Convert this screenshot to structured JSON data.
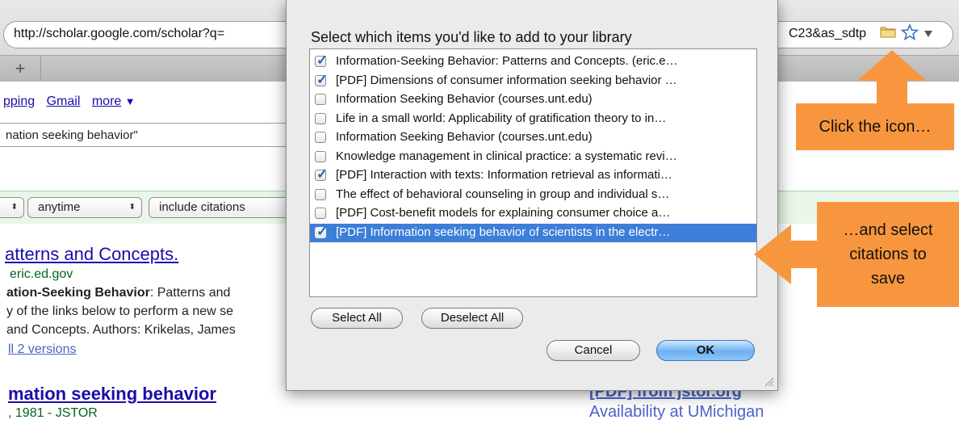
{
  "browser": {
    "url_left": "http://scholar.google.com/scholar?q=",
    "url_right": "C23&as_sdtp",
    "new_tab_label": "+"
  },
  "page": {
    "nav": {
      "shopping": "pping",
      "gmail": "Gmail",
      "more": "more",
      "more_caret": "▼"
    },
    "search_value": "nation seeking behavior\"",
    "filters": {
      "first_arrow": "⬍",
      "anytime": "anytime",
      "citations": "include citations"
    },
    "result1": {
      "title": "atterns and Concepts.",
      "source": "eric.ed.gov",
      "snippet1_bold": "ation-Seeking Behavior",
      "snippet1_rest": ": Patterns and",
      "snippet2": "y of the links below to perform a new se",
      "snippet3": "and Concepts. Authors: Krikelas, James",
      "versions": "ll 2 versions"
    },
    "result2": {
      "title": "mation seeking behavior",
      "source": ", 1981 - JSTOR"
    },
    "right_links": {
      "pdf_jstor": "[PDF] from jstor.org",
      "availability": "Availability at UMichigan"
    }
  },
  "dialog": {
    "title": "Select which items you'd like to add to your library",
    "items": [
      {
        "label": "Information-Seeking Behavior: Patterns and Concepts. (eric.e…",
        "checked": true,
        "selected": false
      },
      {
        "label": "[PDF] Dimensions of consumer information seeking behavior …",
        "checked": true,
        "selected": false
      },
      {
        "label": "Information Seeking Behavior (courses.unt.edu)",
        "checked": false,
        "selected": false
      },
      {
        "label": "Life in a small world: Applicability of gratification theory to in…",
        "checked": false,
        "selected": false
      },
      {
        "label": "Information Seeking Behavior (courses.unt.edu)",
        "checked": false,
        "selected": false
      },
      {
        "label": "Knowledge management in clinical practice: a systematic revi…",
        "checked": false,
        "selected": false
      },
      {
        "label": "[PDF] Interaction with texts: Information retrieval as informati…",
        "checked": true,
        "selected": false
      },
      {
        "label": "The effect of behavioral counseling in group and individual s…",
        "checked": false,
        "selected": false
      },
      {
        "label": "[PDF] Cost-benefit models for explaining consumer choice a…",
        "checked": false,
        "selected": false
      },
      {
        "label": "[PDF] Information seeking behavior of scientists in the electr…",
        "checked": true,
        "selected": true
      }
    ],
    "select_all": "Select All",
    "deselect_all": "Deselect All",
    "cancel": "Cancel",
    "ok": "OK"
  },
  "callouts": {
    "click_icon": "Click the icon…",
    "select_line1": "…and select",
    "select_line2": "citations to",
    "select_line3": "save"
  },
  "colors": {
    "callout": "#f7963e",
    "selection": "#3c7ed8",
    "link": "#1a0dab",
    "source_green": "#006621"
  }
}
